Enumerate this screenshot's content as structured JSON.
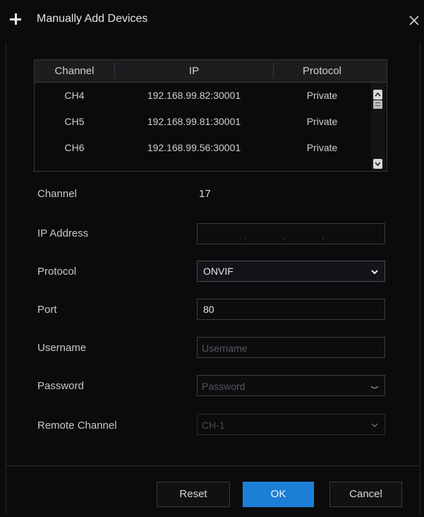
{
  "dialog": {
    "title": "Manually Add Devices"
  },
  "table": {
    "columns": [
      "Channel",
      "IP",
      "Protocol"
    ],
    "rows": [
      {
        "channel": "CH4",
        "ip": "192.168.99.82:30001",
        "protocol": "Private"
      },
      {
        "channel": "CH5",
        "ip": "192.168.99.81:30001",
        "protocol": "Private"
      },
      {
        "channel": "CH6",
        "ip": "192.168.99.56:30001",
        "protocol": "Private"
      }
    ]
  },
  "form": {
    "channel_label": "Channel",
    "channel_value": "17",
    "ip_label": "IP Address",
    "ip_separator": ".",
    "protocol_label": "Protocol",
    "protocol_value": "ONVIF",
    "port_label": "Port",
    "port_value": "80",
    "username_label": "Username",
    "username_placeholder": "Username",
    "password_label": "Password",
    "password_placeholder": "Password",
    "remote_channel_label": "Remote Channel",
    "remote_channel_value": "CH-1"
  },
  "buttons": {
    "reset": "Reset",
    "ok": "OK",
    "cancel": "Cancel"
  },
  "colors": {
    "background": "#0b0b0d",
    "accent": "#1c7fd7",
    "text": "#d2d2d2",
    "border": "#3c3c40"
  },
  "icons": [
    "plus-icon",
    "close-icon",
    "scroll-up-icon",
    "scroll-down-icon",
    "chevron-down-icon"
  ]
}
